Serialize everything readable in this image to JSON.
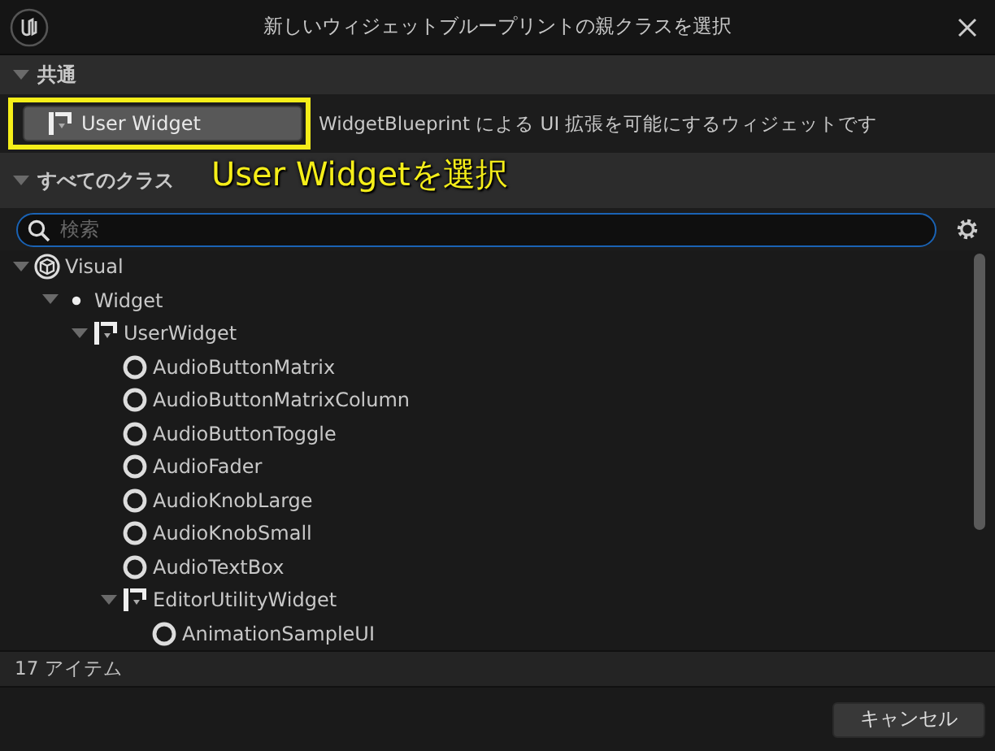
{
  "window": {
    "title": "新しいウィジェットブループリントの親クラスを選択"
  },
  "common": {
    "header": "共通",
    "expanded": true,
    "button": "User Widget",
    "description": "WidgetBlueprint による UI 拡張を可能にするウィジェットです"
  },
  "annotation": "User Widgetを選択",
  "all_classes": {
    "header": "すべてのクラス",
    "expanded": true,
    "search": {
      "placeholder": "検索"
    },
    "tree": [
      {
        "label": "Visual",
        "kind": "visual",
        "expanded": true,
        "children": [
          {
            "label": "Widget",
            "kind": "widget",
            "expanded": true,
            "children": [
              {
                "label": "UserWidget",
                "kind": "userwidget",
                "expanded": true,
                "children": [
                  {
                    "label": "AudioButtonMatrix",
                    "kind": "class"
                  },
                  {
                    "label": "AudioButtonMatrixColumn",
                    "kind": "class"
                  },
                  {
                    "label": "AudioButtonToggle",
                    "kind": "class"
                  },
                  {
                    "label": "AudioFader",
                    "kind": "class"
                  },
                  {
                    "label": "AudioKnobLarge",
                    "kind": "class"
                  },
                  {
                    "label": "AudioKnobSmall",
                    "kind": "class"
                  },
                  {
                    "label": "AudioTextBox",
                    "kind": "class"
                  },
                  {
                    "label": "EditorUtilityWidget",
                    "kind": "userwidget",
                    "expanded": true,
                    "children": [
                      {
                        "label": "AnimationSampleUI",
                        "kind": "class"
                      }
                    ]
                  }
                ]
              }
            ]
          }
        ]
      }
    ]
  },
  "status_bar": "17 アイテム",
  "buttons": [
    "キャンセル"
  ]
}
